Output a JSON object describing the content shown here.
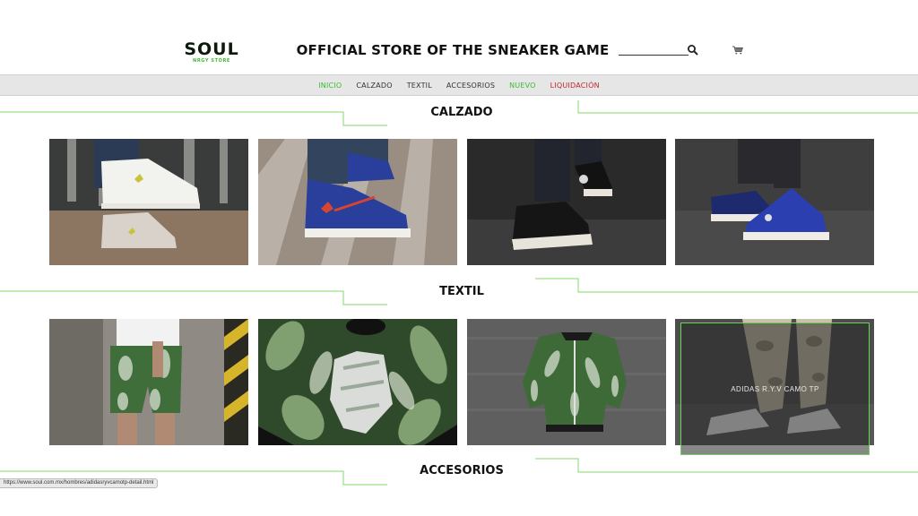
{
  "logo": {
    "word": "SOUL",
    "sub": "NRGY STORE"
  },
  "header": {
    "tagline": "OFFICIAL STORE OF THE SNEAKER GAME",
    "search_value": ""
  },
  "nav": [
    {
      "label": "INICIO",
      "color": "#3dbb2f"
    },
    {
      "label": "CALZADO",
      "color": "#333333"
    },
    {
      "label": "TEXTIL",
      "color": "#333333"
    },
    {
      "label": "ACCESORIOS",
      "color": "#333333"
    },
    {
      "label": "NUEVO",
      "color": "#3dbb2f"
    },
    {
      "label": "LIQUIDACIÓN",
      "color": "#c0262d"
    }
  ],
  "sections": {
    "calzado": "CALZADO",
    "textil": "TEXTIL",
    "accesorios": "ACCESORIOS"
  },
  "hover_overlay": {
    "label": "ADIDAS R.Y.V CAMO TP"
  },
  "status_url": "https://www.soul.com.mx/hombres/adidasryvcamotp-detail.html",
  "colors": {
    "accent_green": "#3dbb2f",
    "sale_red": "#c0262d",
    "nav_bg": "#e6e6e6"
  }
}
